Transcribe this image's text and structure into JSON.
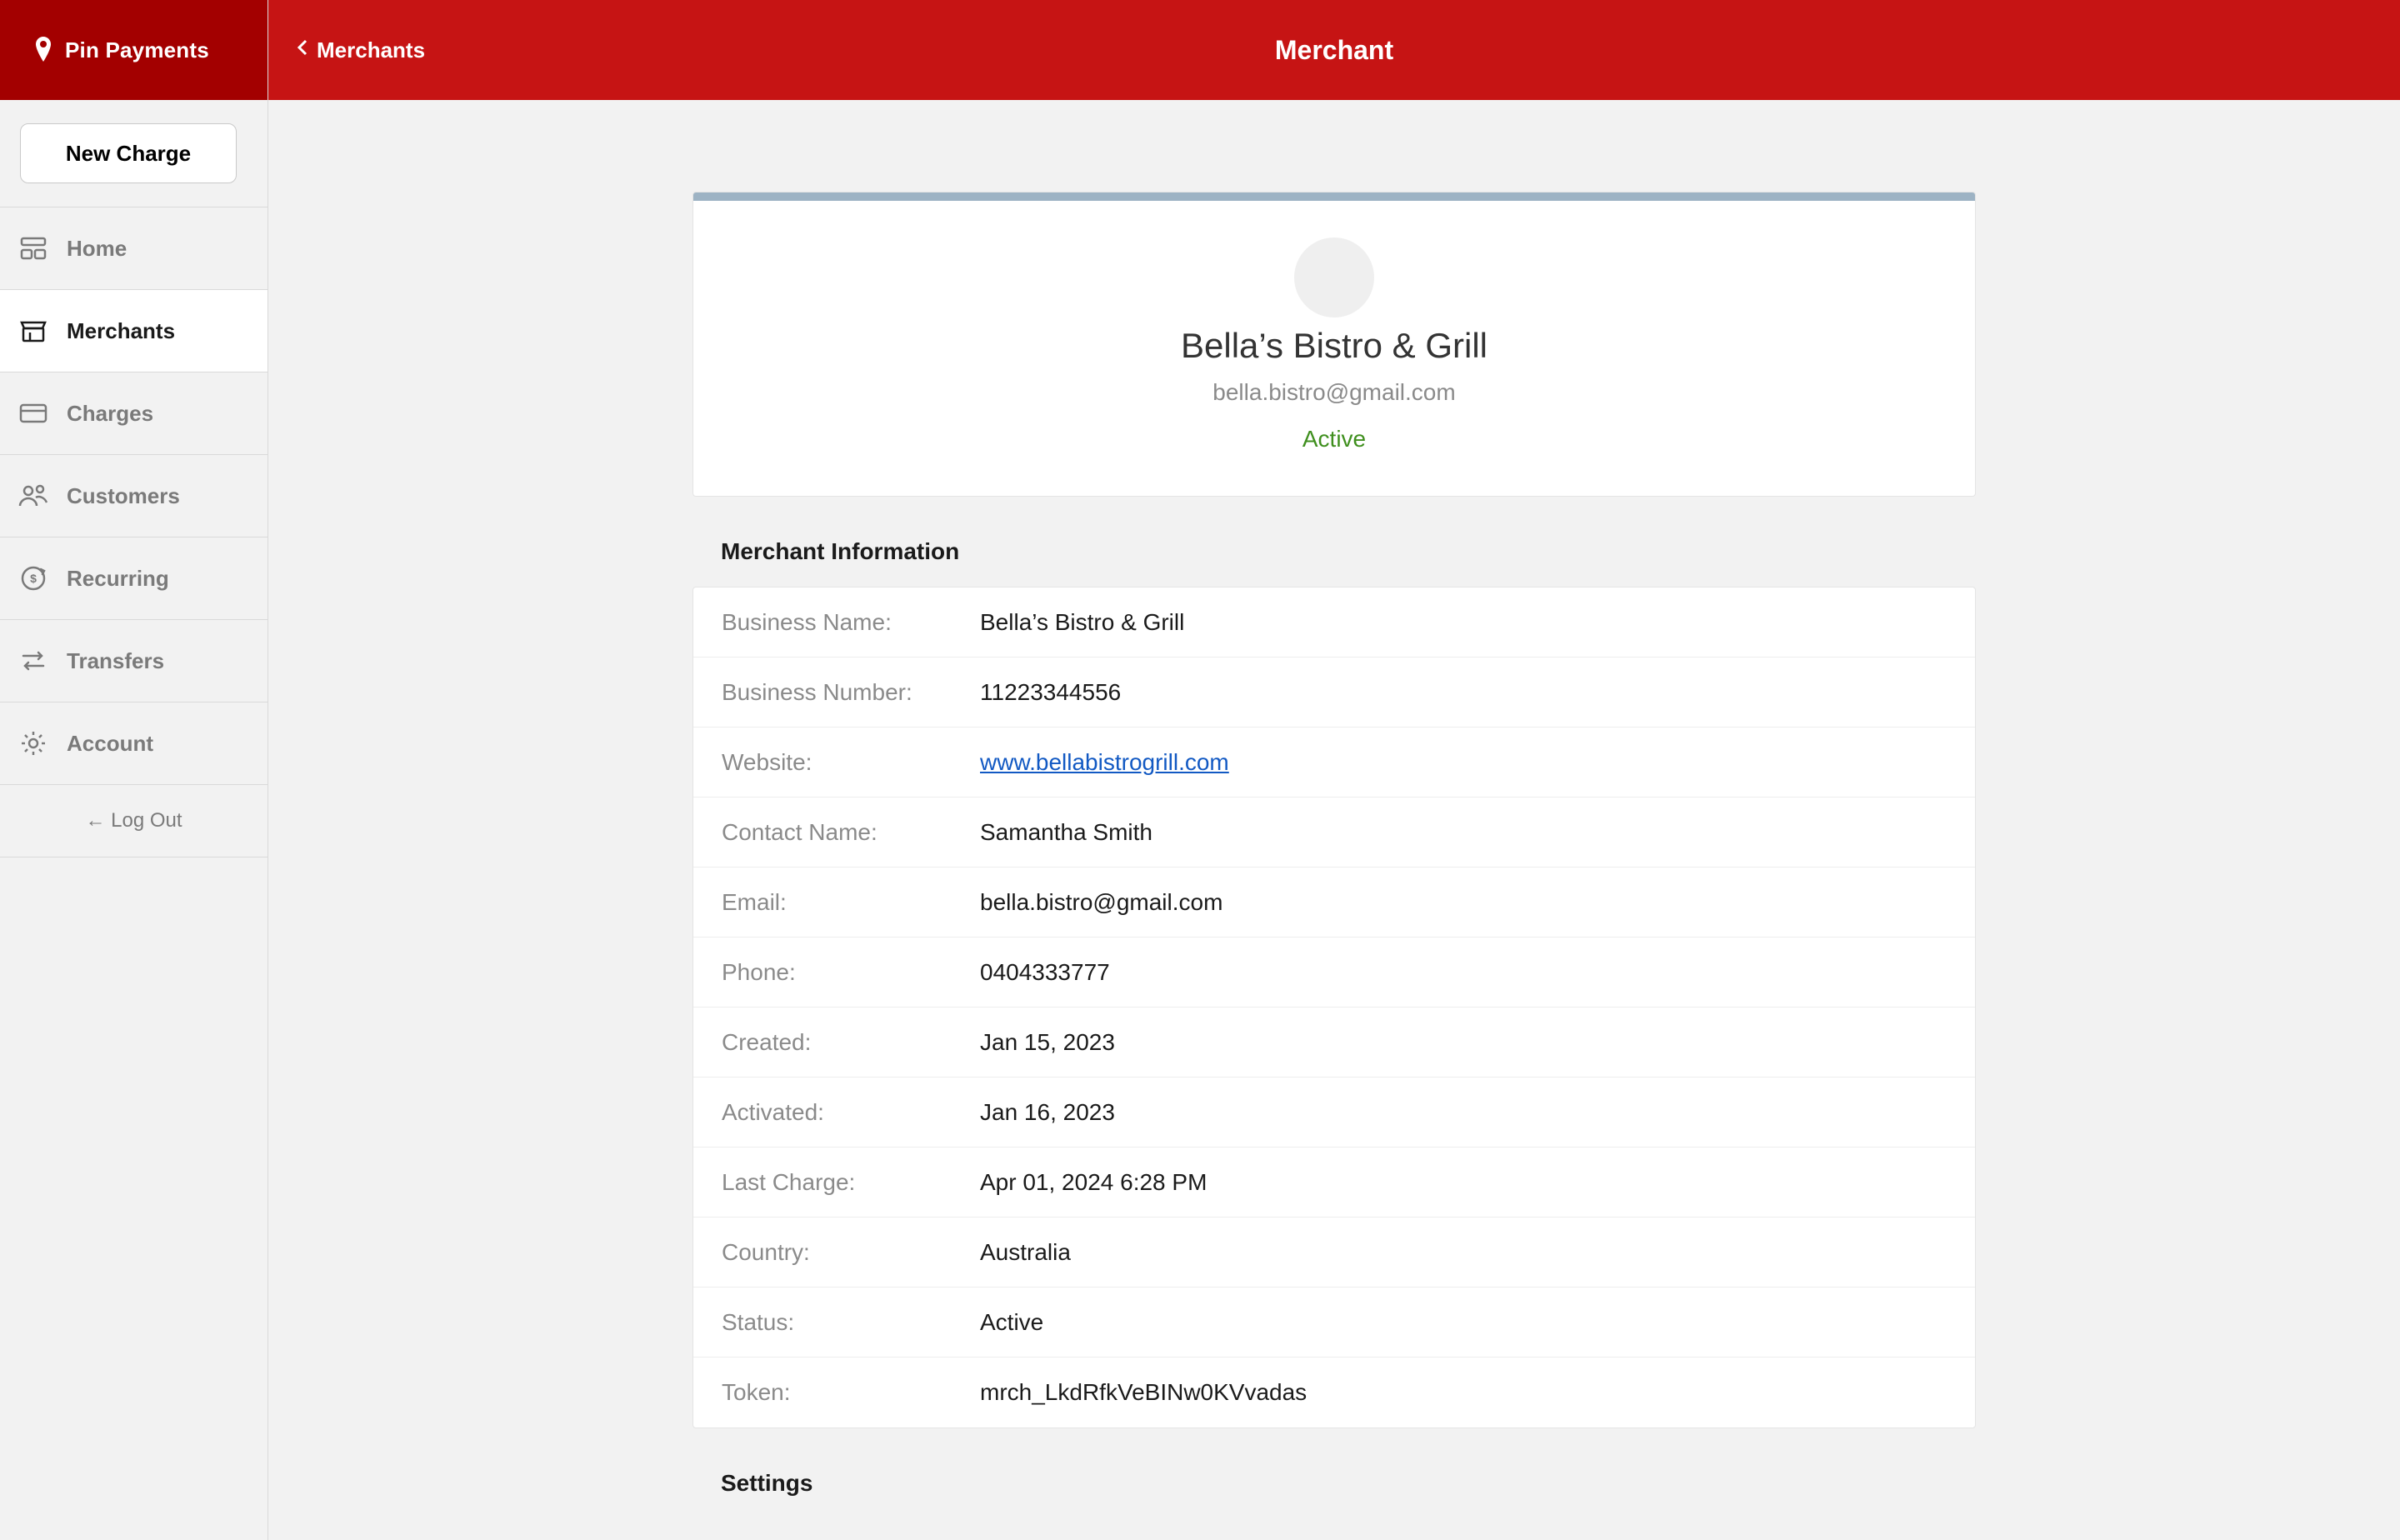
{
  "brand": {
    "name": "Pin Payments"
  },
  "sidebar": {
    "new_charge_label": "New Charge",
    "items": [
      {
        "label": "Home",
        "icon": "home-icon"
      },
      {
        "label": "Merchants",
        "icon": "merchants-icon"
      },
      {
        "label": "Charges",
        "icon": "charges-icon"
      },
      {
        "label": "Customers",
        "icon": "customers-icon"
      },
      {
        "label": "Recurring",
        "icon": "recurring-icon"
      },
      {
        "label": "Transfers",
        "icon": "transfers-icon"
      },
      {
        "label": "Account",
        "icon": "account-icon"
      }
    ],
    "active_index": 1,
    "logout_label": "← Log Out"
  },
  "topbar": {
    "back_label": "Merchants",
    "title": "Merchant"
  },
  "merchant_header": {
    "name": "Bella’s Bistro & Grill",
    "email": "bella.bistro@gmail.com",
    "status": "Active",
    "status_color": "#3f8f1e"
  },
  "sections": {
    "info_title": "Merchant Information",
    "settings_title": "Settings"
  },
  "merchant_info": [
    {
      "label": "Business Name:",
      "value": "Bella’s Bistro & Grill"
    },
    {
      "label": "Business Number:",
      "value": "11223344556"
    },
    {
      "label": "Website:",
      "value": "www.bellabistrogrill.com",
      "is_link": true
    },
    {
      "label": "Contact Name:",
      "value": "Samantha Smith"
    },
    {
      "label": "Email:",
      "value": "bella.bistro@gmail.com"
    },
    {
      "label": "Phone:",
      "value": "0404333777"
    },
    {
      "label": "Created:",
      "value": "Jan 15, 2023"
    },
    {
      "label": "Activated:",
      "value": "Jan 16, 2023"
    },
    {
      "label": "Last Charge:",
      "value": "Apr 01, 2024 6:28 PM"
    },
    {
      "label": "Country:",
      "value": "Australia"
    },
    {
      "label": "Status:",
      "value": "Active"
    },
    {
      "label": "Token:",
      "value": "mrch_LkdRfkVeBINw0KVvadas"
    }
  ]
}
